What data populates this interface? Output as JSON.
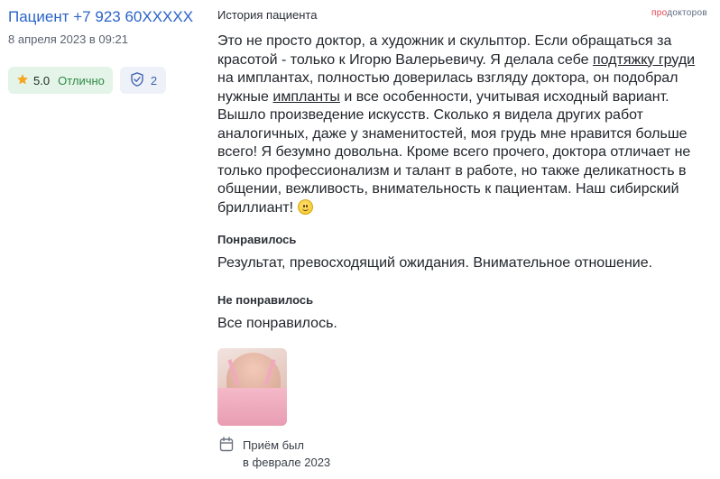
{
  "author": {
    "name": "Пациент +7 923 60XXXXX",
    "date": "8 апреля 2023 в 09:21"
  },
  "rating": {
    "value": "5.0",
    "label": "Отлично"
  },
  "verified": {
    "count": "2"
  },
  "logo": {
    "pro": "про",
    "rest": "докторов"
  },
  "story": {
    "label": "История пациента",
    "part1": "Это не просто доктор, а художник и скульптор. Если обращаться за красотой - только к Игорю Валерьевичу. Я делала себе ",
    "link1": "подтяжку груди",
    "part2": " на имплантах, полностью доверилась взгляду доктора, он подобрал нужные ",
    "link2": "импланты",
    "part3": " и все особенности, учитывая исходный вариант. Вышло произведение искусств. Сколько я видела других работ аналогичных, даже у знаменитостей, моя грудь мне нравится больше всего! Я безумно довольна. Кроме всего прочего, доктора отличает не только профессионализм и талант в работе, но также деликатность в общении, вежливость, внимательность к пациентам. Наш сибирский бриллиант! "
  },
  "liked": {
    "label": "Понравилось",
    "text": "Результат, превосходящий ожидания. Внимательное отношение."
  },
  "disliked": {
    "label": "Не понравилось",
    "text": "Все понравилось."
  },
  "visit": {
    "line1": "Приём был",
    "line2": "в феврале 2023"
  }
}
